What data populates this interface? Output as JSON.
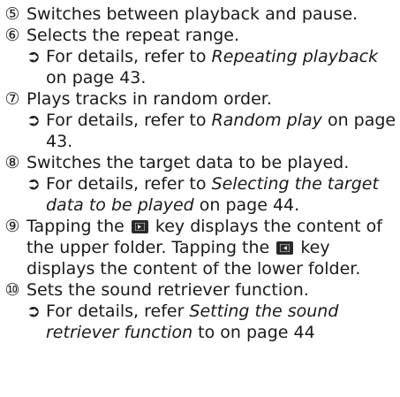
{
  "items": [
    {
      "num": "⑤",
      "text": "Switches between playback and pause."
    },
    {
      "num": "⑥",
      "text": "Selects the repeat range.",
      "ref": {
        "arrow": "➲",
        "pre": "For details, refer to ",
        "title": "Repeating playback",
        "post": " on page 43."
      }
    },
    {
      "num": "⑦",
      "text": "Plays tracks in random order.",
      "ref": {
        "arrow": "➲",
        "pre": "For details, refer to ",
        "title": "Random play",
        "post": " on page 43."
      }
    },
    {
      "num": "⑧",
      "text": "Switches the target data to be played.",
      "ref": {
        "arrow": "➲",
        "pre": "For details, refer to ",
        "title": "Selecting the target data to be played",
        "post": " on page 44."
      }
    },
    {
      "num": "⑨",
      "text_a": "Tapping the ",
      "text_b": " key displays the content of the upper folder. Tapping the ",
      "text_c": " key displays the content of the lower folder.",
      "icon_a": "folder-up-key-icon",
      "icon_b": "folder-down-key-icon"
    },
    {
      "num": "⑩",
      "text": "Sets the sound retriever function.",
      "ref": {
        "arrow": "➲",
        "pre": "For details, refer ",
        "title": "Setting the sound retriever function",
        "post": " to on page 44"
      }
    }
  ],
  "colors": {
    "text": "#1a1a1a",
    "key_bg": "#2a2a2a",
    "key_glyph": "#e8e8e8"
  }
}
